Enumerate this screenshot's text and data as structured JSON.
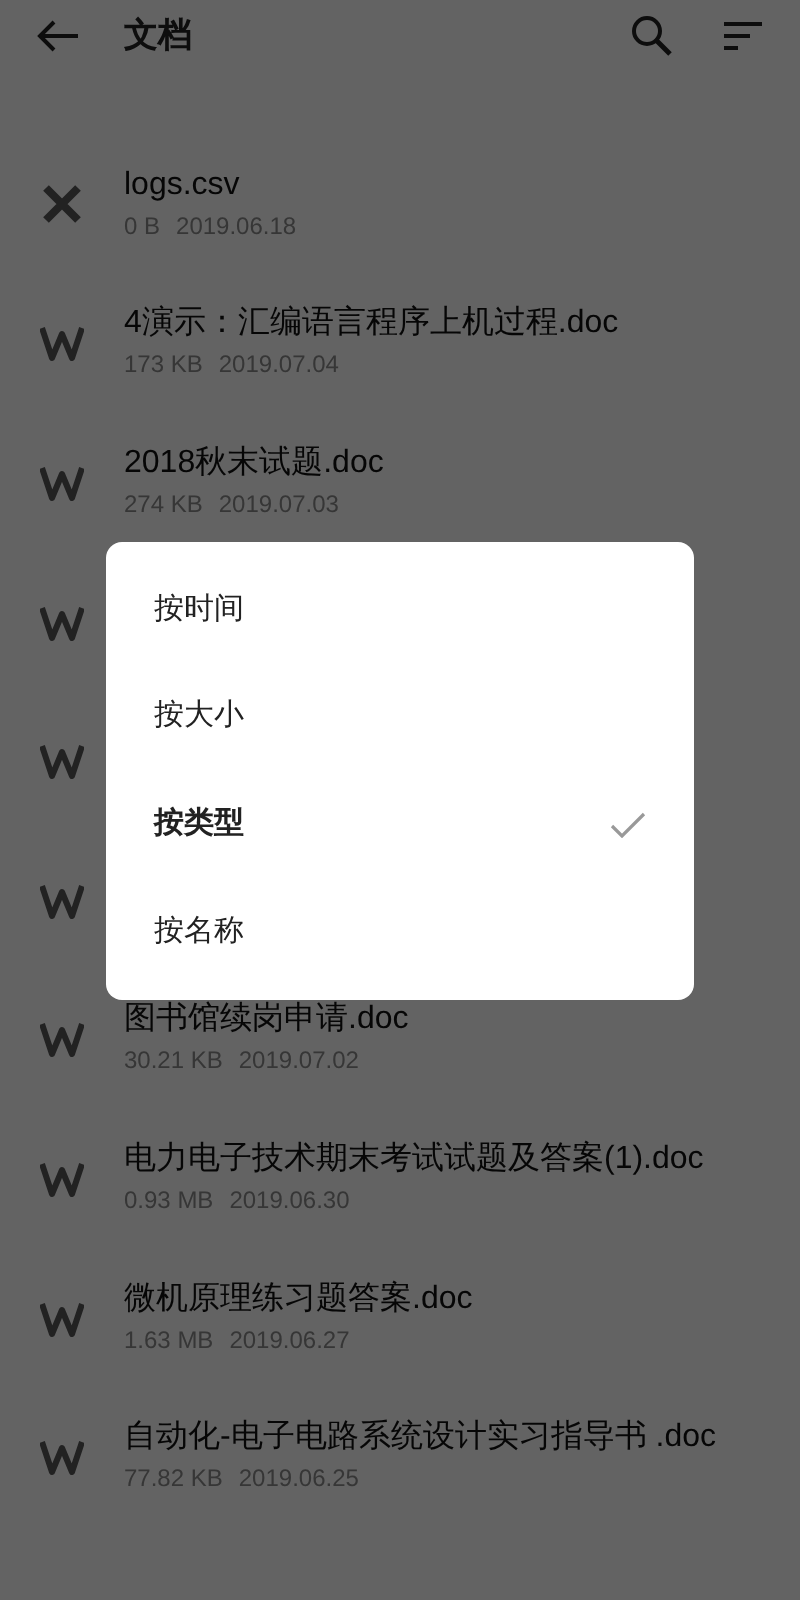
{
  "header": {
    "title": "文档"
  },
  "files": [
    {
      "kind": "csv",
      "name": "logs.csv",
      "size": "0 B",
      "date": "2019.06.18"
    },
    {
      "kind": "doc",
      "name": "4演示：汇编语言程序上机过程.doc",
      "size": "173 KB",
      "date": "2019.07.04"
    },
    {
      "kind": "doc",
      "name": "2018秋末试题.doc",
      "size": "274 KB",
      "date": "2019.07.03"
    },
    {
      "kind": "doc"
    },
    {
      "kind": "doc"
    },
    {
      "kind": "doc"
    },
    {
      "kind": "doc",
      "name": "图书馆续岗申请.doc",
      "size": "30.21 KB",
      "date": "2019.07.02"
    },
    {
      "kind": "doc",
      "name": "电力电子技术期末考试试题及答案(1).doc",
      "size": "0.93 MB",
      "date": "2019.06.30"
    },
    {
      "kind": "doc",
      "name": "微机原理练习题答案.doc",
      "size": "1.63 MB",
      "date": "2019.06.27"
    },
    {
      "kind": "doc",
      "name": "自动化-电子电路系统设计实习指导书 .doc",
      "size": "77.82 KB",
      "date": "2019.06.25"
    }
  ],
  "sort_dialog": {
    "options": [
      {
        "label": "按时间",
        "selected": false
      },
      {
        "label": "按大小",
        "selected": false
      },
      {
        "label": "按类型",
        "selected": true
      },
      {
        "label": "按名称",
        "selected": false
      }
    ]
  }
}
